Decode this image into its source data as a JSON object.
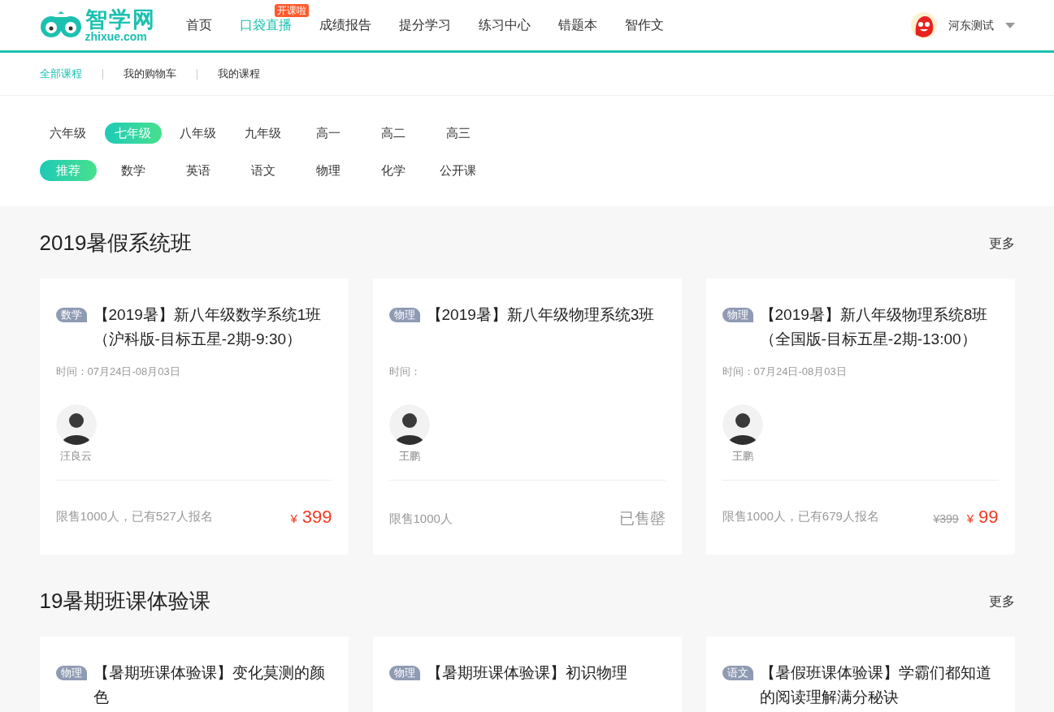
{
  "logo": {
    "name": "智学网",
    "domain": "zhixue.com"
  },
  "nav": [
    {
      "label": "首页",
      "selected": false
    },
    {
      "label": "口袋直播",
      "selected": true,
      "badge": "开课啦"
    },
    {
      "label": "成绩报告",
      "selected": false
    },
    {
      "label": "提分学习",
      "selected": false
    },
    {
      "label": "练习中心",
      "selected": false
    },
    {
      "label": "错题本",
      "selected": false
    },
    {
      "label": "智作文",
      "selected": false
    }
  ],
  "user": {
    "name": "河东测试"
  },
  "subnav": [
    {
      "label": "全部课程",
      "selected": true
    },
    {
      "label": "我的购物车",
      "selected": false
    },
    {
      "label": "我的课程",
      "selected": false
    }
  ],
  "grades": [
    {
      "label": "六年级",
      "selected": false
    },
    {
      "label": "七年级",
      "selected": true
    },
    {
      "label": "八年级",
      "selected": false
    },
    {
      "label": "九年级",
      "selected": false
    },
    {
      "label": "高一",
      "selected": false
    },
    {
      "label": "高二",
      "selected": false
    },
    {
      "label": "高三",
      "selected": false
    }
  ],
  "subjects": [
    {
      "label": "推荐",
      "selected": true
    },
    {
      "label": "数学",
      "selected": false
    },
    {
      "label": "英语",
      "selected": false
    },
    {
      "label": "语文",
      "selected": false
    },
    {
      "label": "物理",
      "selected": false
    },
    {
      "label": "化学",
      "selected": false
    },
    {
      "label": "公开课",
      "selected": false
    }
  ],
  "sections": [
    {
      "title": "2019暑假系统班",
      "more": "更多",
      "courses": [
        {
          "tag": "数学",
          "title": "【2019暑】新八年级数学系统1班（沪科版-目标五星-2期-9:30）",
          "date": "时间：07月24日-08月03日",
          "teacher": "汪良云",
          "quota": "限售1000人，已有527人报名",
          "kind": "on_sale",
          "currency": "¥",
          "price": "399"
        },
        {
          "tag": "物理",
          "title": "【2019暑】新八年级物理系统3班",
          "date": "时间：",
          "teacher": "王鹏",
          "quota": "限售1000人",
          "kind": "sold_out",
          "status": "已售罄"
        },
        {
          "tag": "物理",
          "title": "【2019暑】新八年级物理系统8班（全国版-目标五星-2期-13:00）",
          "date": "时间：07月24日-08月03日",
          "teacher": "王鹏",
          "quota": "限售1000人，已有679人报名",
          "kind": "discount",
          "original_price": "¥399",
          "currency": "¥",
          "price": "99"
        }
      ]
    },
    {
      "title": "19暑期班课体验课",
      "more": "更多",
      "courses": [
        {
          "tag": "物理",
          "title": "【暑期班课体验课】变化莫测的颜色"
        },
        {
          "tag": "物理",
          "title": "【暑期班课体验课】初识物理"
        },
        {
          "tag": "语文",
          "title": "【暑假班课体验课】学霸们都知道的阅读理解满分秘诀"
        }
      ]
    }
  ]
}
